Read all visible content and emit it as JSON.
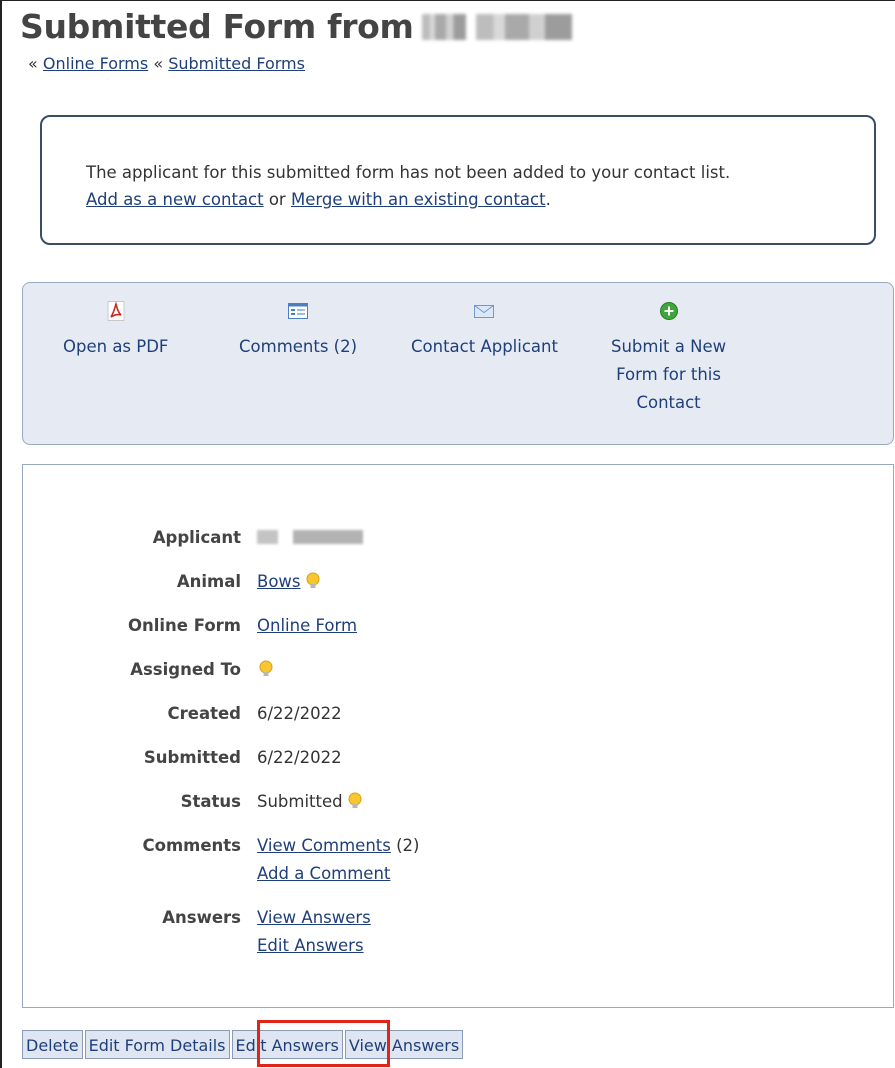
{
  "header": {
    "title": "Submitted Form from"
  },
  "breadcrumb": {
    "sep": "«",
    "items": [
      "Online Forms",
      "Submitted Forms"
    ]
  },
  "notice": {
    "message": "The applicant for this submitted form has not been added to your contact list.",
    "add_link": "Add as a new contact",
    "or": " or ",
    "merge_link": "Merge with an existing contact",
    "end": "."
  },
  "actions": [
    {
      "label": "Open as PDF",
      "icon": "pdf-icon"
    },
    {
      "label": "Comments (2)",
      "icon": "comments-icon"
    },
    {
      "label": "Contact Applicant",
      "icon": "envelope-icon"
    },
    {
      "label_lines": [
        "Submit a New",
        "Form for this",
        "Contact"
      ],
      "icon": "add-circle-icon"
    }
  ],
  "details": {
    "applicant_label": "Applicant",
    "animal_label": "Animal",
    "animal_value": "Bows",
    "online_form_label": "Online Form",
    "online_form_value": "Online Form",
    "assigned_label": "Assigned To",
    "created_label": "Created",
    "created_value": "6/22/2022",
    "submitted_label": "Submitted",
    "submitted_value": "6/22/2022",
    "status_label": "Status",
    "status_value": "Submitted",
    "comments_label": "Comments",
    "view_comments": "View Comments",
    "comments_count": " (2)",
    "add_comment": "Add a Comment",
    "answers_label": "Answers",
    "view_answers": "View Answers",
    "edit_answers": "Edit Answers"
  },
  "buttons": {
    "delete": "Delete",
    "edit_form_details": "Edit Form Details",
    "edit_answers": "Edit Answers",
    "view_answers": "View Answers"
  },
  "colors": {
    "link": "#1f3f7a",
    "panel_bg": "#e6ebf3",
    "highlight": "#e0241a"
  }
}
